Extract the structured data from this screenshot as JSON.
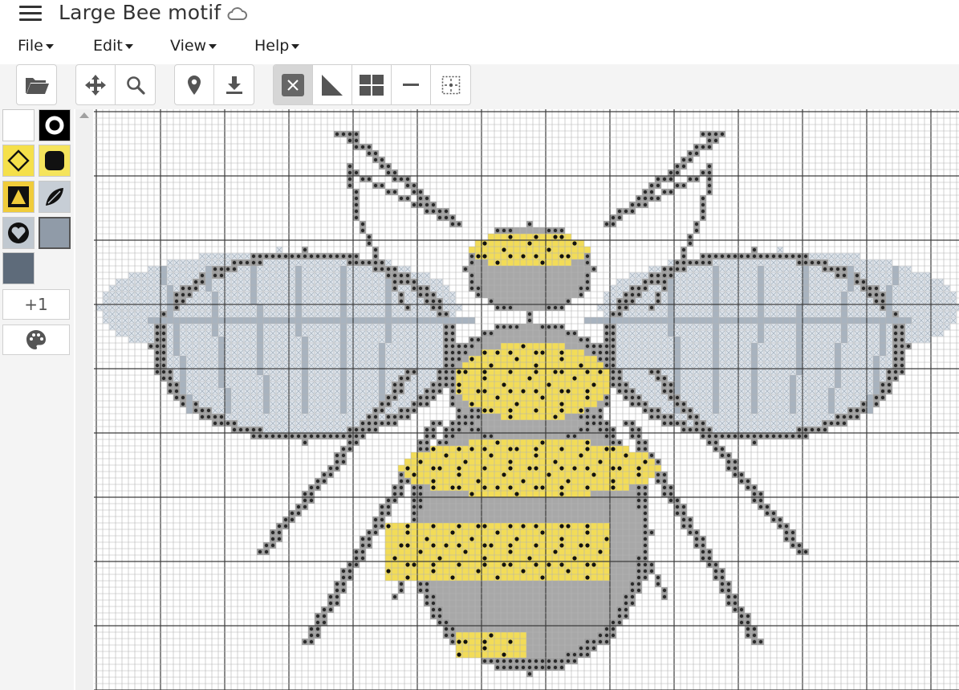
{
  "app": {
    "title": "Large Bee motif",
    "icons": {
      "menu": "hamburger-icon",
      "sync": "cloud-icon"
    }
  },
  "menu": {
    "items": [
      {
        "label": "File",
        "icon": "chevron-down-icon"
      },
      {
        "label": "Edit",
        "icon": "chevron-down-icon"
      },
      {
        "label": "View",
        "icon": "chevron-down-icon"
      },
      {
        "label": "Help",
        "icon": "chevron-down-icon"
      }
    ]
  },
  "toolbar": {
    "groups": [
      {
        "buttons": [
          {
            "icon": "folder-open-icon",
            "active": false
          }
        ]
      },
      {
        "buttons": [
          {
            "icon": "move-arrows-icon",
            "active": false
          },
          {
            "icon": "search-icon",
            "active": false
          }
        ]
      },
      {
        "buttons": [
          {
            "icon": "map-marker-icon",
            "active": false
          },
          {
            "icon": "download-icon",
            "active": false
          }
        ]
      },
      {
        "buttons": [
          {
            "icon": "full-cross-stitch-icon",
            "active": true
          },
          {
            "icon": "half-stitch-icon",
            "active": false
          },
          {
            "icon": "quarter-stitch-icon",
            "active": false
          },
          {
            "icon": "backstitch-icon",
            "active": false
          },
          {
            "icon": "french-knot-icon",
            "active": false
          }
        ]
      }
    ]
  },
  "palette": {
    "swatches": [
      {
        "color": "#ffffff",
        "symbol": "none",
        "selected": false
      },
      {
        "color": "#000000",
        "symbol": "ring",
        "symbol_color": "#ffffff",
        "selected": false
      },
      {
        "color": "#f5e04a",
        "symbol": "diamond-outline",
        "symbol_color": "#111111",
        "selected": false
      },
      {
        "color": "#f5e45c",
        "symbol": "filled-square",
        "symbol_color": "#111111",
        "selected": false
      },
      {
        "color": "#f0cc3a",
        "symbol": "triangle",
        "symbol_color": "#111111",
        "selected": false
      },
      {
        "color": "#c7ced6",
        "symbol": "leaf",
        "symbol_color": "#111111",
        "selected": false
      },
      {
        "color": "#c0c8d0",
        "symbol": "heart",
        "symbol_color": "#111111",
        "selected": false
      },
      {
        "color": "#909ba8",
        "symbol": "none",
        "selected": true
      },
      {
        "color": "#5e6b7a",
        "symbol": "none",
        "selected": false
      }
    ],
    "add_label": "+1",
    "colors_button_icon": "palette-icon"
  },
  "canvas": {
    "grid_color": "#b4b4b4",
    "major_grid_color": "#3c3c3c",
    "colors": {
      "outline": "#9a9a9a",
      "body": "#a8a8a8",
      "yellow": "#f2dc58",
      "black_dot": "#111111",
      "wing_fill": "#dfe5ec",
      "wing_vein": "#a8b3bf"
    }
  }
}
